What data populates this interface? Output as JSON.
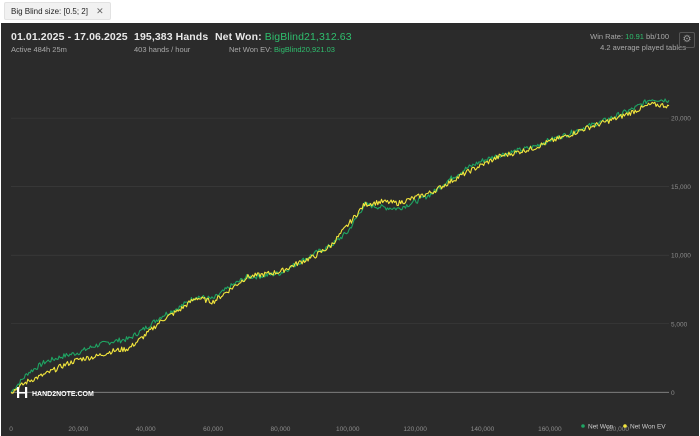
{
  "filter": {
    "label": "Big Blind size: [0.5; 2]",
    "close": "✕"
  },
  "header": {
    "date_range": "01.01.2025 - 17.06.2025",
    "active": "Active 484h 25m",
    "hands_title": "195,383 Hands",
    "hands_rate": "403 hands / hour",
    "net_won_label": "Net Won:",
    "net_won_value": "BigBlind21,312.63",
    "ev_label": "Net Won  EV:",
    "ev_value": "BigBlind20,921.03",
    "win_rate_label": "Win Rate:",
    "win_rate_value": "10.91",
    "win_rate_unit": "bb/100",
    "avg_tables": "4.2 average played tables",
    "settings_icon": "gear-icon"
  },
  "logo": {
    "text": "HAND2NOTE.COM"
  },
  "colors": {
    "net_won": "#1fa463",
    "ev": "#f3e63c",
    "accent": "#2fbf6e"
  },
  "chart_data": {
    "type": "line",
    "xlim": [
      0,
      195383
    ],
    "ylim": [
      -1000,
      23000
    ],
    "x_ticks": [
      0,
      20000,
      40000,
      60000,
      80000,
      100000,
      120000,
      140000,
      160000,
      180000
    ],
    "x_tick_labels": [
      "0",
      "20,000",
      "40,000",
      "60,000",
      "80,000",
      "100,000",
      "120,000",
      "140,000",
      "160,000",
      "180,000"
    ],
    "y_ticks": [
      0,
      5000,
      10000,
      15000,
      20000
    ],
    "y_tick_labels": [
      "0",
      "5,000",
      "10,000",
      "15,000",
      "20,000"
    ],
    "grid": true,
    "legend_position": "bottom-right",
    "series": [
      {
        "name": "Net Won",
        "x": [
          0,
          5000,
          10000,
          15000,
          20000,
          25000,
          30000,
          35000,
          40000,
          45000,
          50000,
          55000,
          60000,
          65000,
          70000,
          75000,
          80000,
          85000,
          90000,
          95000,
          100000,
          105000,
          110000,
          115000,
          120000,
          125000,
          130000,
          135000,
          140000,
          145000,
          150000,
          155000,
          160000,
          165000,
          170000,
          175000,
          180000,
          185000,
          190000,
          195383
        ],
        "y": [
          0,
          1400,
          2200,
          2600,
          2900,
          3400,
          3700,
          3900,
          4700,
          5600,
          6200,
          7000,
          6800,
          7700,
          8400,
          8500,
          8700,
          9400,
          10100,
          10700,
          11700,
          13700,
          13500,
          13400,
          13900,
          14500,
          15500,
          16300,
          16900,
          17300,
          17600,
          17900,
          18400,
          18800,
          19300,
          19700,
          20200,
          20700,
          21400,
          21300
        ]
      },
      {
        "name": "Net Won  EV",
        "x": [
          0,
          5000,
          10000,
          15000,
          20000,
          25000,
          30000,
          35000,
          40000,
          45000,
          50000,
          55000,
          60000,
          65000,
          70000,
          75000,
          80000,
          85000,
          90000,
          95000,
          100000,
          105000,
          110000,
          115000,
          120000,
          125000,
          130000,
          135000,
          140000,
          145000,
          150000,
          155000,
          160000,
          165000,
          170000,
          175000,
          180000,
          185000,
          190000,
          195383
        ],
        "y": [
          0,
          800,
          1300,
          1900,
          2400,
          2600,
          3000,
          3200,
          4200,
          5300,
          6000,
          6900,
          6600,
          7500,
          8400,
          8600,
          8800,
          9400,
          9900,
          10700,
          12200,
          13700,
          13900,
          13800,
          14200,
          14600,
          15300,
          16000,
          16600,
          17200,
          17500,
          17800,
          18300,
          18700,
          19200,
          19600,
          20000,
          20500,
          21000,
          20900
        ]
      }
    ]
  }
}
